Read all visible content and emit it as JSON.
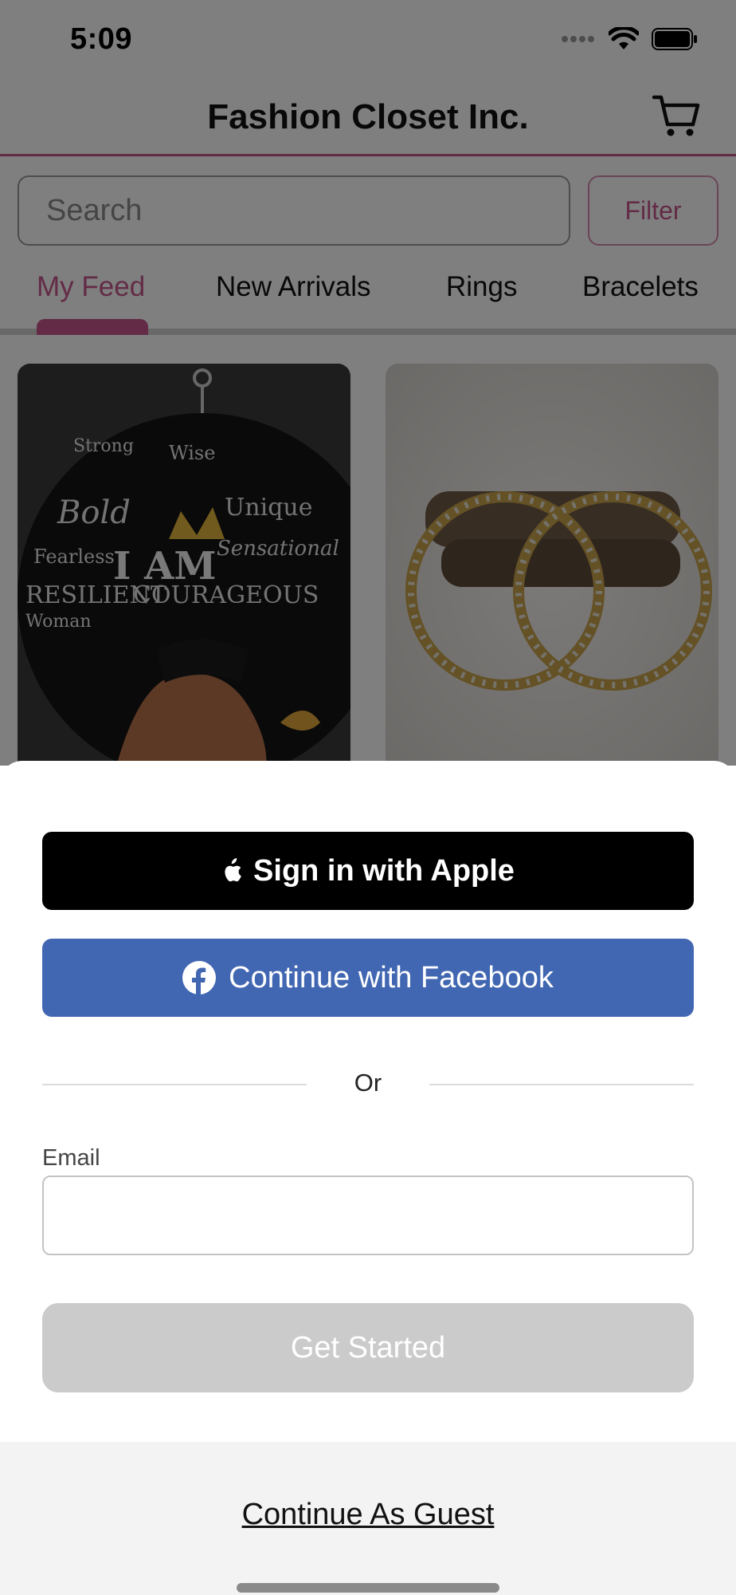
{
  "status_bar": {
    "time": "5:09"
  },
  "header": {
    "title": "Fashion Closet Inc.",
    "cart_icon": "cart-icon"
  },
  "search": {
    "placeholder": "Search",
    "value": ""
  },
  "filter": {
    "label": "Filter"
  },
  "tabs": [
    {
      "label": "My Feed",
      "active": true
    },
    {
      "label": "New Arrivals",
      "active": false
    },
    {
      "label": "Rings",
      "active": false
    },
    {
      "label": "Bracelets",
      "active": false
    }
  ],
  "products": [
    {
      "image": "afro-portrait-earring",
      "words": [
        "I AM",
        "COURAGEOUS",
        "RESILIENT",
        "Unique",
        "Sensational",
        "Bold",
        "Strong",
        "Wise",
        "Fearless",
        "Woman"
      ]
    },
    {
      "image": "gold-rhinestone-hoop-earrings"
    }
  ],
  "login_sheet": {
    "apple_label": "Sign in with Apple",
    "facebook_label": "Continue with Facebook",
    "divider": "Or",
    "email_label": "Email",
    "email_value": "",
    "submit_label": "Get Started",
    "guest_label": "Continue As Guest"
  },
  "colors": {
    "accent": "#c6578c",
    "facebook": "#4267b2",
    "apple": "#000000",
    "disabled": "#cbcbcb"
  }
}
